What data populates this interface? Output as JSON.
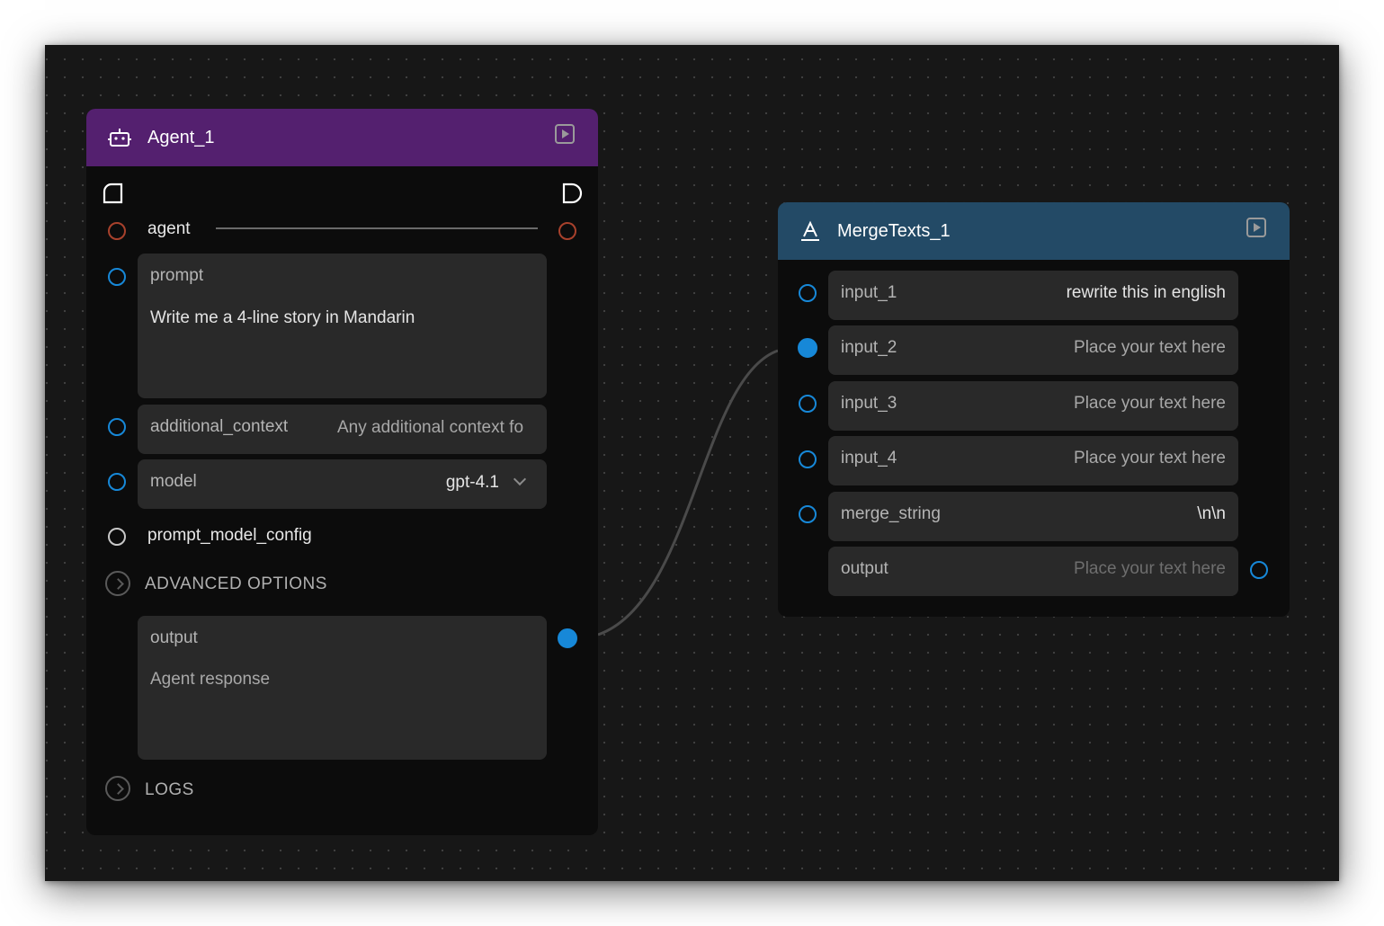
{
  "agent_node": {
    "title": "Agent_1",
    "header_color": "#54206f",
    "agent_label": "agent",
    "prompt": {
      "label": "prompt",
      "value": "Write me a 4-line story in Mandarin"
    },
    "additional_context": {
      "label": "additional_context",
      "placeholder": "Any additional context fo"
    },
    "model": {
      "label": "model",
      "value": "gpt-4.1"
    },
    "prompt_model_config_label": "prompt_model_config",
    "advanced_options_label": "ADVANCED OPTIONS",
    "output": {
      "label": "output",
      "placeholder": "Agent response"
    },
    "logs_label": "LOGS"
  },
  "merge_node": {
    "title": "MergeTexts_1",
    "header_color": "#234a66",
    "inputs": [
      {
        "label": "input_1",
        "value": "rewrite this in english",
        "connected": false
      },
      {
        "label": "input_2",
        "value": "Place your text here",
        "connected": true
      },
      {
        "label": "input_3",
        "value": "Place your text here",
        "connected": false
      },
      {
        "label": "input_4",
        "value": "Place your text here",
        "connected": false
      }
    ],
    "merge_string": {
      "label": "merge_string",
      "value": "\\n\\n"
    },
    "output": {
      "label": "output",
      "placeholder": "Place your text here"
    }
  },
  "colors": {
    "canvas_bg": "#171717",
    "handle_blue": "#1788d8",
    "handle_orange": "#a8412c",
    "field_bg": "#292929"
  }
}
